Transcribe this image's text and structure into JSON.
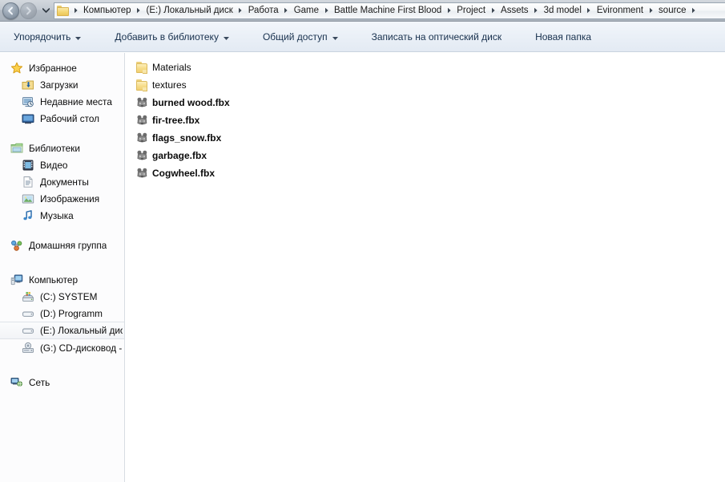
{
  "window": {
    "title": "source"
  },
  "addressbar": {
    "back_icon": "back-arrow-icon",
    "forward_icon": "forward-arrow-icon",
    "history_icon": "chevron-down-icon",
    "folder_icon": "folder-icon",
    "crumbs": [
      "Компьютер",
      "(E:) Локальный диск",
      "Работа",
      "Game",
      "Battle Machine First Blood",
      "Project",
      "Assets",
      "3d model",
      "Evironment",
      "source"
    ]
  },
  "toolbar": {
    "items": [
      {
        "label": "Упорядочить",
        "has_caret": true
      },
      {
        "label": "Добавить в библиотеку",
        "has_caret": true
      },
      {
        "label": "Общий доступ",
        "has_caret": true
      },
      {
        "label": "Записать на оптический диск",
        "has_caret": false
      },
      {
        "label": "Новая папка",
        "has_caret": false
      }
    ]
  },
  "sidebar": {
    "sections": [
      {
        "header": {
          "label": "Избранное",
          "icon": "star-icon"
        },
        "items": [
          {
            "label": "Загрузки",
            "icon": "downloads-icon"
          },
          {
            "label": "Недавние места",
            "icon": "recent-places-icon"
          },
          {
            "label": "Рабочий стол",
            "icon": "desktop-icon"
          }
        ]
      },
      {
        "header": {
          "label": "Библиотеки",
          "icon": "libraries-icon"
        },
        "items": [
          {
            "label": "Видео",
            "icon": "video-icon"
          },
          {
            "label": "Документы",
            "icon": "documents-icon"
          },
          {
            "label": "Изображения",
            "icon": "pictures-icon"
          },
          {
            "label": "Музыка",
            "icon": "music-icon"
          }
        ]
      },
      {
        "header": {
          "label": "Домашняя группа",
          "icon": "homegroup-icon"
        },
        "items": []
      },
      {
        "header": {
          "label": "Компьютер",
          "icon": "computer-icon"
        },
        "items": [
          {
            "label": "(C:) SYSTEM",
            "icon": "system-drive-icon",
            "selected": false
          },
          {
            "label": "(D:) Programm",
            "icon": "drive-icon",
            "selected": false
          },
          {
            "label": "(E:) Локальный диск",
            "icon": "drive-icon",
            "selected": true
          },
          {
            "label": "(G:) CD-дисковод - D",
            "icon": "cd-drive-icon",
            "selected": false
          }
        ]
      },
      {
        "header": {
          "label": "Сеть",
          "icon": "network-icon"
        },
        "items": []
      }
    ]
  },
  "filelist": {
    "items": [
      {
        "name": "Materials",
        "type": "folder",
        "icon": "folder-icon"
      },
      {
        "name": "textures",
        "type": "folder",
        "icon": "folder-icon"
      },
      {
        "name": "burned wood.fbx",
        "type": "fbx",
        "icon": "fbx-file-icon"
      },
      {
        "name": "fir-tree.fbx",
        "type": "fbx",
        "icon": "fbx-file-icon"
      },
      {
        "name": "flags_snow.fbx",
        "type": "fbx",
        "icon": "fbx-file-icon"
      },
      {
        "name": "garbage.fbx",
        "type": "fbx",
        "icon": "fbx-file-icon"
      },
      {
        "name": "Cogwheel.fbx",
        "type": "fbx",
        "icon": "fbx-file-icon"
      }
    ]
  },
  "colors": {
    "addressbar_top": "#d3d8de",
    "addressbar_bottom": "#a9b2bc",
    "toolbar_bg": "#eaf0f7",
    "sidebar_bg": "#fcfcfd",
    "content_bg": "#ffffff",
    "folder_yellow": "#f7dd8c",
    "divider": "#d8dde3"
  }
}
